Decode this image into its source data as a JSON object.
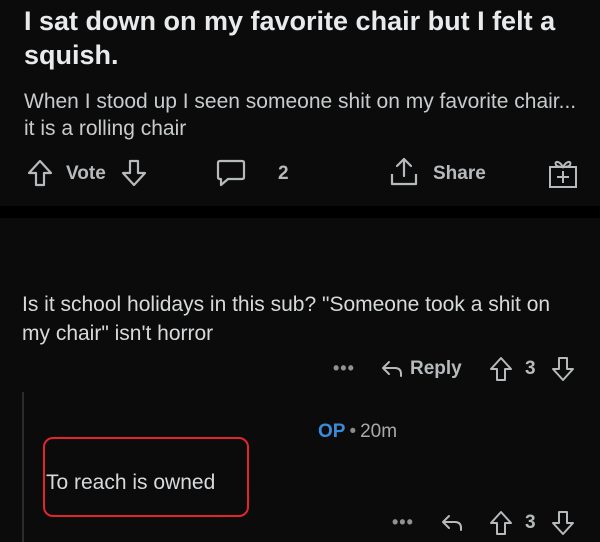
{
  "post": {
    "title": "I sat down on my favorite chair but I felt a squish.",
    "body": "When I stood up I seen someone shit on my favorite chair... it is a rolling chair",
    "vote_label": "Vote",
    "comment_count": "2",
    "share_label": "Share"
  },
  "comment": {
    "text": "Is it school holidays in this sub? \"Someone took a shit on my chair\" isn't horror",
    "more_label": "•••",
    "reply_label": "Reply",
    "score": "3"
  },
  "reply": {
    "author": "OP",
    "separator": "•",
    "time": "20m",
    "text": "To reach is owned",
    "more_label": "•••",
    "score": "3"
  },
  "colors": {
    "background": "#000000",
    "card": "#0b0b0b",
    "op_accent": "#3c8bd8",
    "highlight": "#e0262c"
  },
  "icons": [
    "upvote-icon",
    "downvote-icon",
    "comment-icon",
    "share-icon",
    "award-icon",
    "reply-arrow-icon"
  ]
}
